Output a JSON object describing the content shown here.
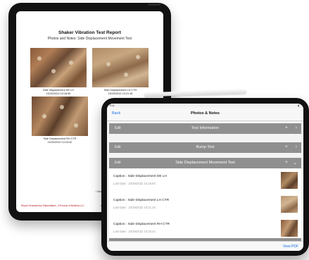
{
  "report": {
    "title": "Shaker Vibration Test Report",
    "subtitle": "Photos and Notes: Side Displacement Movement Test",
    "photos": [
      {
        "caption": "Side Displacement DE LH",
        "date": "10/20/2022 10:18:50"
      },
      {
        "caption": "Side Displacement LH CTR",
        "date": "10/20/2022 10:21:16"
      },
      {
        "caption": "Side Displacement RH CTR",
        "date": "10/20/2022 10:23:42"
      }
    ],
    "brand": "ShakerWatch",
    "footer_left": "Report Generated by ShakerWatch - A Product of Multiviva LLC",
    "footer_right": "www.mult"
  },
  "app": {
    "nav": {
      "back_label": "Back",
      "title": "Photos & Notes"
    },
    "sections": [
      {
        "edit": "Edit",
        "label": "Test Information",
        "plus": "+",
        "chevron": "›"
      },
      {
        "edit": "Edit",
        "label": "Bump Test",
        "plus": "+",
        "chevron": "›"
      },
      {
        "edit": "Edit",
        "label": "Side Displacement Movement Test",
        "plus": "+",
        "chevron": "⌄"
      }
    ],
    "rows": [
      {
        "caption": "Caption : Side Displacement DE LH",
        "date": "Last Date : 10/20/2022 10:18:50"
      },
      {
        "caption": "Caption : Side Displacement LH CTR",
        "date": "Last Date : 10/20/2022 10:21:16"
      },
      {
        "caption": "Caption : Side Displacement RH CTR",
        "date": "Last Date : 10/20/2022 10:23:42"
      }
    ],
    "toolbar": {
      "view_pdf": "View PDF"
    }
  }
}
